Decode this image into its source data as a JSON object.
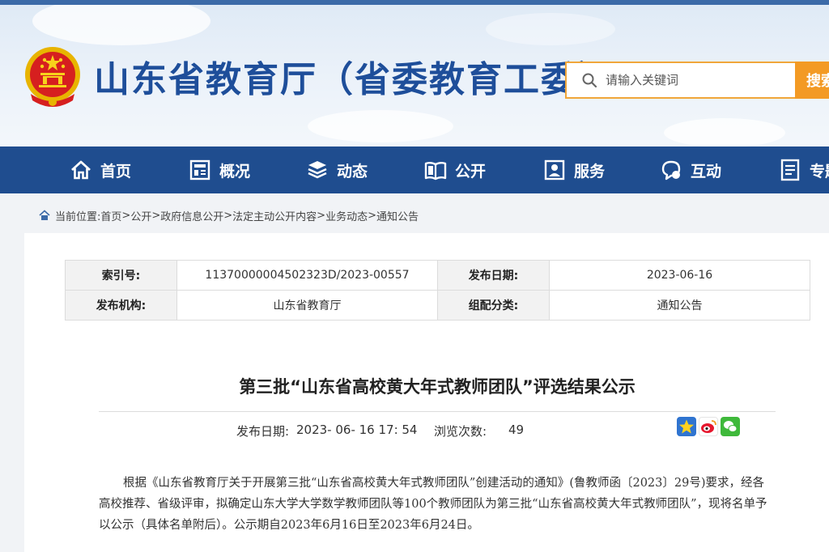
{
  "header": {
    "site_title": "山东省教育厅（省委教育工委）",
    "search_placeholder": "请输入关键词",
    "search_button": "搜索"
  },
  "nav": {
    "items": [
      {
        "label": "首页",
        "icon": "home-icon"
      },
      {
        "label": "概况",
        "icon": "overview-icon"
      },
      {
        "label": "动态",
        "icon": "news-icon"
      },
      {
        "label": "公开",
        "icon": "book-icon"
      },
      {
        "label": "服务",
        "icon": "service-icon"
      },
      {
        "label": "互动",
        "icon": "chat-icon"
      },
      {
        "label": "专题",
        "icon": "document-icon"
      }
    ]
  },
  "breadcrumb": {
    "prefix": "当前位置: ",
    "items": [
      "首页",
      "公开",
      "政府信息公开",
      "法定主动公开内容",
      "业务动态",
      "通知公告"
    ],
    "separator": "> "
  },
  "meta": {
    "index_label": "索引号:",
    "index_value": "11370000004502323D/2023-00557",
    "date_label": "发布日期:",
    "date_value": "2023-06-16",
    "org_label": "发布机构:",
    "org_value": "山东省教育厅",
    "category_label": "组配分类:",
    "category_value": "通知公告"
  },
  "article": {
    "title": "第三批“山东省高校黄大年式教师团队”评选结果公示",
    "pub_date_label": "发布日期:",
    "pub_date_value": "2023- 06- 16 17: 54",
    "views_label": "浏览次数:",
    "views_value": "49",
    "body": "根据《山东省教育厅关于开展第三批“山东省高校黄大年式教师团队”创建活动的通知》(鲁教师函〔2023〕29号)要求，经各高校推荐、省级评审，拟确定山东大学大学数学教师团队等100个教师团队为第三批“山东省高校黄大年式教师团队”，现将名单予以公示（具体名单附后）。公示期自2023年6月16日至2023年6月24日。"
  },
  "colors": {
    "brand_blue": "#1f4d8f",
    "title_blue": "#1e4e9a",
    "search_orange": "#f39a24"
  }
}
